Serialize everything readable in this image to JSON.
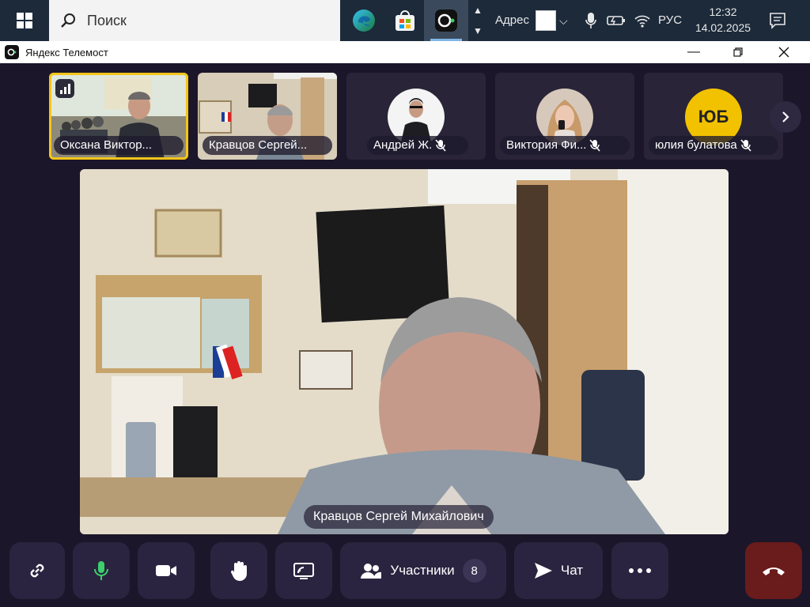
{
  "taskbar": {
    "search_label": "Поиск",
    "address_label": "Адрес",
    "language": "РУС",
    "time": "12:32",
    "date": "14.02.2025",
    "apps": [
      "edge-icon",
      "store-icon",
      "telemost-icon"
    ],
    "tray": [
      "chevron-down-icon",
      "microphone-icon",
      "battery-icon",
      "wifi-icon"
    ]
  },
  "window": {
    "title": "Яндекс Телемост"
  },
  "participants_strip": [
    {
      "name": "Оксана Виктор...",
      "type": "video",
      "active": true
    },
    {
      "name": "Кравцов Сергей...",
      "type": "video",
      "active": false
    },
    {
      "name": "Андрей Ж.",
      "type": "avatar",
      "muted": true
    },
    {
      "name": "Виктория Фи...",
      "type": "avatar",
      "muted": true
    },
    {
      "name": "юлия булатова",
      "type": "initials",
      "initials": "ЮБ",
      "muted": true
    }
  ],
  "main_video": {
    "speaker_name": "Кравцов Сергей Михайлович"
  },
  "toolbar": {
    "participants_label": "Участники",
    "participants_count": "8",
    "chat_label": "Чат"
  },
  "colors": {
    "background": "#1b1629",
    "button": "#2a2440",
    "active_outline": "#f5c518",
    "hangup": "#6a1b1b",
    "mic_on": "#3ccf6a",
    "initials_avatar": "#f2c200"
  }
}
